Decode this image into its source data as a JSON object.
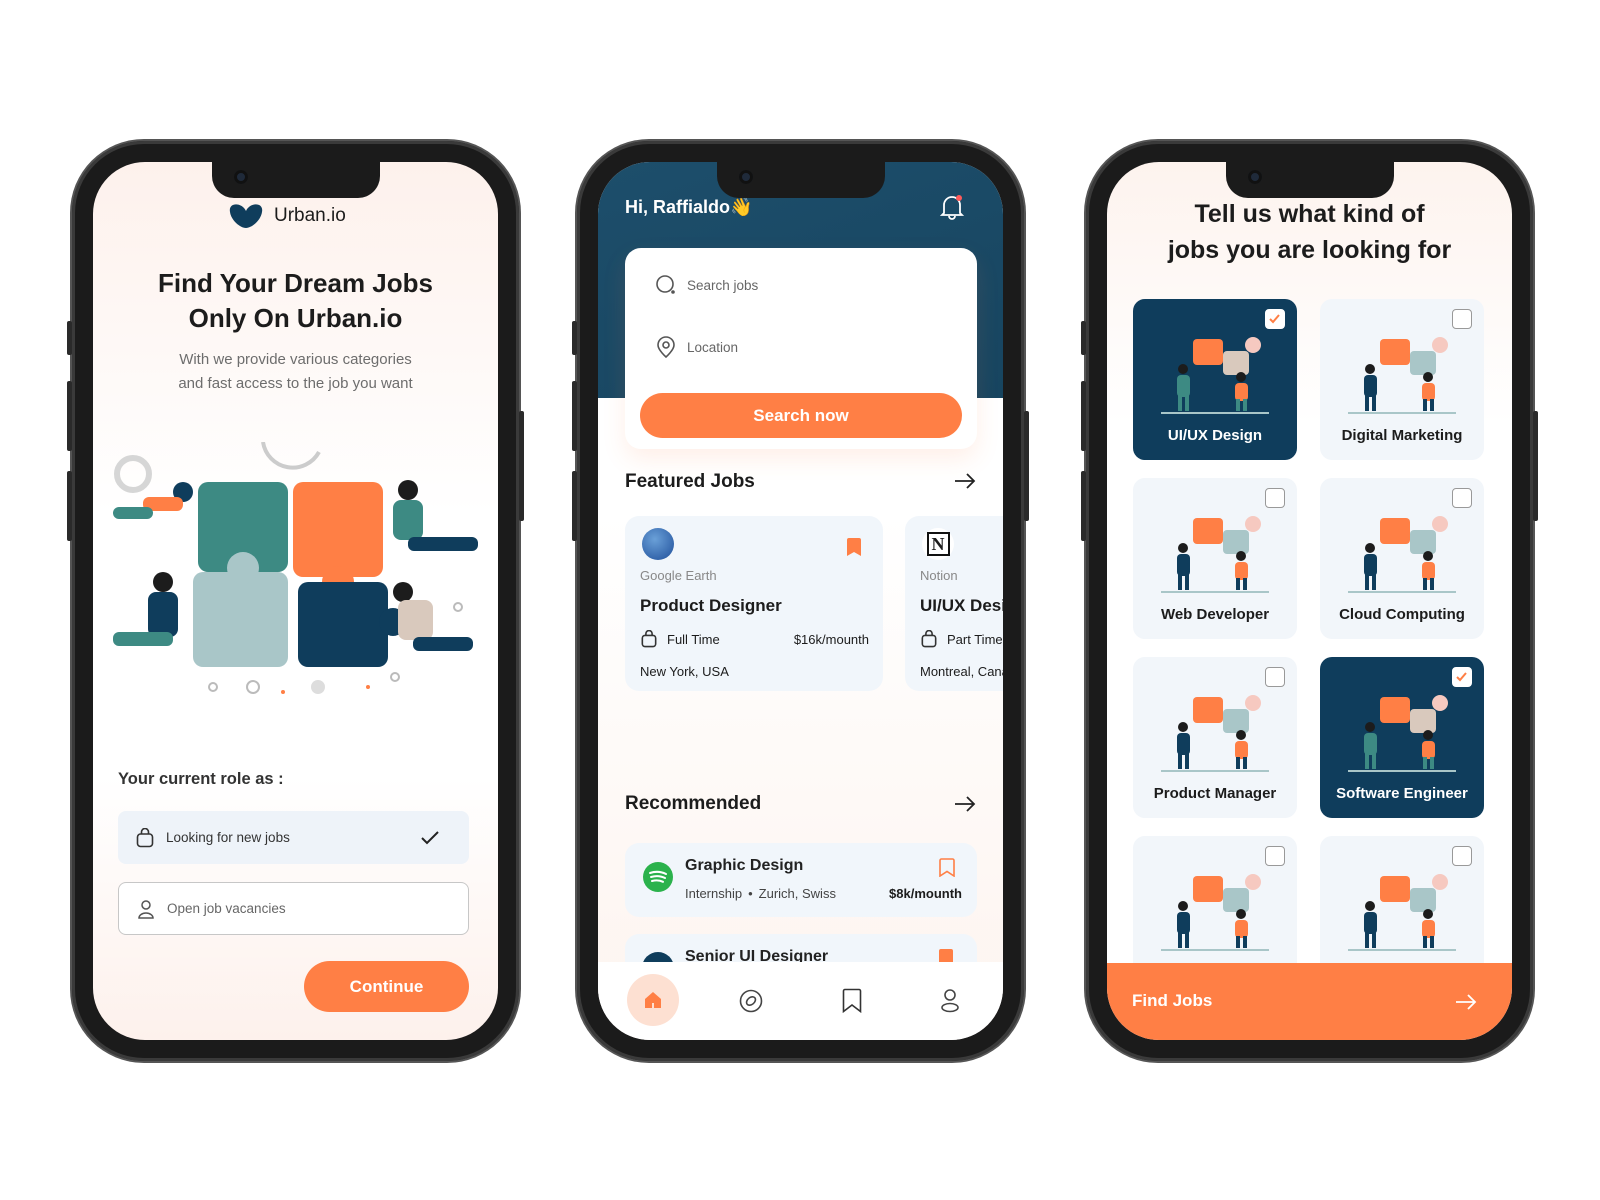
{
  "colors": {
    "accent": "#ff7f45",
    "brand_dark": "#0f3d5c",
    "header": "#1d4e6b",
    "card_bg": "#f1f6fb"
  },
  "onboarding": {
    "brand": "Urban.io",
    "title_line1": "Find Your Dream Jobs",
    "title_line2": "Only On Urban.io",
    "subtitle_line1": "With we provide various categories",
    "subtitle_line2": "and fast access to the job you want",
    "role_label": "Your current role as :",
    "options": [
      {
        "label": "Looking for new jobs",
        "icon": "bag-icon",
        "selected": true
      },
      {
        "label": "Open job vacancies",
        "icon": "user-icon",
        "selected": false
      }
    ],
    "continue_label": "Continue"
  },
  "home": {
    "greeting": "Hi, Raffialdo👋",
    "search_placeholder": "Search jobs",
    "location_placeholder": "Location",
    "search_button": "Search now",
    "featured_title": "Featured Jobs",
    "featured": [
      {
        "company": "Google Earth",
        "title": "Product Designer",
        "type": "Full Time",
        "salary": "$16k/mounth",
        "location": "New York, USA",
        "bookmarked": true
      },
      {
        "company": "Notion",
        "title": "UI/UX Designer",
        "type": "Part Time",
        "salary": "",
        "location": "Montreal, Canada",
        "bookmarked": false
      }
    ],
    "recommended_title": "Recommended",
    "recommended": [
      {
        "title": "Graphic Design",
        "type": "Internship",
        "location": "Zurich, Swiss",
        "salary": "$8k/mounth",
        "bookmarked": false
      },
      {
        "title": "Senior UI Designer",
        "bookmarked": true
      }
    ],
    "nav": [
      {
        "name": "home",
        "active": true
      },
      {
        "name": "explore",
        "active": false
      },
      {
        "name": "saved",
        "active": false
      },
      {
        "name": "profile",
        "active": false
      }
    ]
  },
  "categories": {
    "title_line1": "Tell us what kind of",
    "title_line2": "jobs you are looking for",
    "items": [
      {
        "label": "UI/UX Design",
        "selected": true
      },
      {
        "label": "Digital Marketing",
        "selected": false
      },
      {
        "label": "Web Developer",
        "selected": false
      },
      {
        "label": "Cloud Computing",
        "selected": false
      },
      {
        "label": "Product Manager",
        "selected": false
      },
      {
        "label": "Software Engineer",
        "selected": true
      },
      {
        "label": "",
        "selected": false
      },
      {
        "label": "",
        "selected": false
      }
    ],
    "find_button": "Find Jobs"
  }
}
